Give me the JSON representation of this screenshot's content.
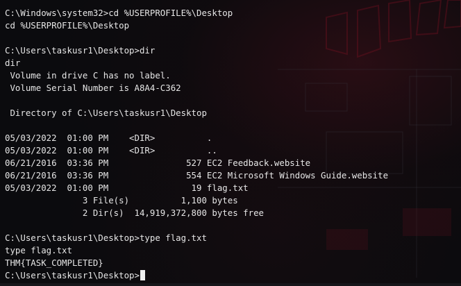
{
  "terminal": {
    "lines": [
      "C:\\Windows\\system32>cd %USERPROFILE%\\Desktop",
      "cd %USERPROFILE%\\Desktop",
      "",
      "C:\\Users\\taskusr1\\Desktop>dir",
      "dir",
      " Volume in drive C has no label.",
      " Volume Serial Number is A8A4-C362",
      "",
      " Directory of C:\\Users\\taskusr1\\Desktop",
      "",
      "05/03/2022  01:00 PM    <DIR>          .",
      "05/03/2022  01:00 PM    <DIR>          ..",
      "06/21/2016  03:36 PM               527 EC2 Feedback.website",
      "06/21/2016  03:36 PM               554 EC2 Microsoft Windows Guide.website",
      "05/03/2022  01:00 PM                19 flag.txt",
      "               3 File(s)          1,100 bytes",
      "               2 Dir(s)  14,919,372,800 bytes free",
      "",
      "C:\\Users\\taskusr1\\Desktop>type flag.txt",
      "type flag.txt",
      "THM{TASK_COMPLETED}",
      "C:\\Users\\taskusr1\\Desktop>"
    ]
  },
  "colors": {
    "text": "#e6e6e6",
    "background": "#0b0b0e",
    "accent": "#7a1423"
  }
}
